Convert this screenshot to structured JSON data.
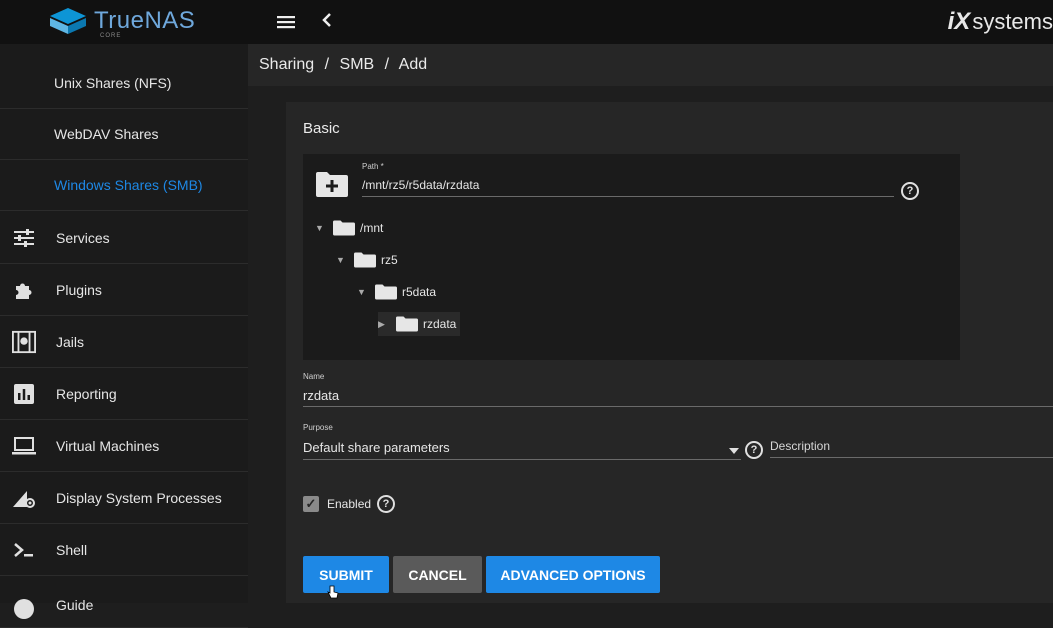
{
  "topbar": {
    "logo_text": "TrueNAS",
    "logo_sub": "CORE",
    "brand_ix": "iX",
    "brand_systems": "systems"
  },
  "sidebar": {
    "items": [
      {
        "label": "Unix Shares (NFS)",
        "icon": "none"
      },
      {
        "label": "WebDAV Shares",
        "icon": "none"
      },
      {
        "label": "Windows Shares (SMB)",
        "icon": "none",
        "active": true
      },
      {
        "label": "Services",
        "icon": "tune-icon"
      },
      {
        "label": "Plugins",
        "icon": "puzzle-icon"
      },
      {
        "label": "Jails",
        "icon": "jail-icon"
      },
      {
        "label": "Reporting",
        "icon": "chart-icon"
      },
      {
        "label": "Virtual Machines",
        "icon": "laptop-icon"
      },
      {
        "label": "Display System Processes",
        "icon": "processes-icon"
      },
      {
        "label": "Shell",
        "icon": "terminal-icon"
      },
      {
        "label": "Guide",
        "icon": "info-icon"
      }
    ]
  },
  "breadcrumb": {
    "part1": "Sharing",
    "sep1": "/",
    "part2": "SMB",
    "sep2": "/",
    "part3": "Add"
  },
  "form": {
    "section_title": "Basic",
    "path": {
      "label": "Path *",
      "value": "/mnt/rz5/r5data/rzdata",
      "help": "?"
    },
    "tree": [
      {
        "caret": "▼",
        "name": "/mnt"
      },
      {
        "caret": "▼",
        "name": "rz5"
      },
      {
        "caret": "▼",
        "name": "r5data"
      },
      {
        "caret": "▶",
        "name": "rzdata"
      }
    ],
    "name": {
      "label": "Name",
      "value": "rzdata"
    },
    "purpose": {
      "label": "Purpose",
      "value": "Default share parameters",
      "help": "?"
    },
    "description": {
      "label": "Description",
      "value": ""
    },
    "enabled": {
      "label": "Enabled",
      "checked": true,
      "check_mark": "✓",
      "help": "?"
    }
  },
  "buttons": {
    "submit": "SUBMIT",
    "cancel": "CANCEL",
    "advanced": "ADVANCED OPTIONS"
  },
  "colors": {
    "accent": "#1e88e5",
    "topbar": "#111111",
    "sidebar": "#1b1b1b",
    "card": "#262626"
  }
}
